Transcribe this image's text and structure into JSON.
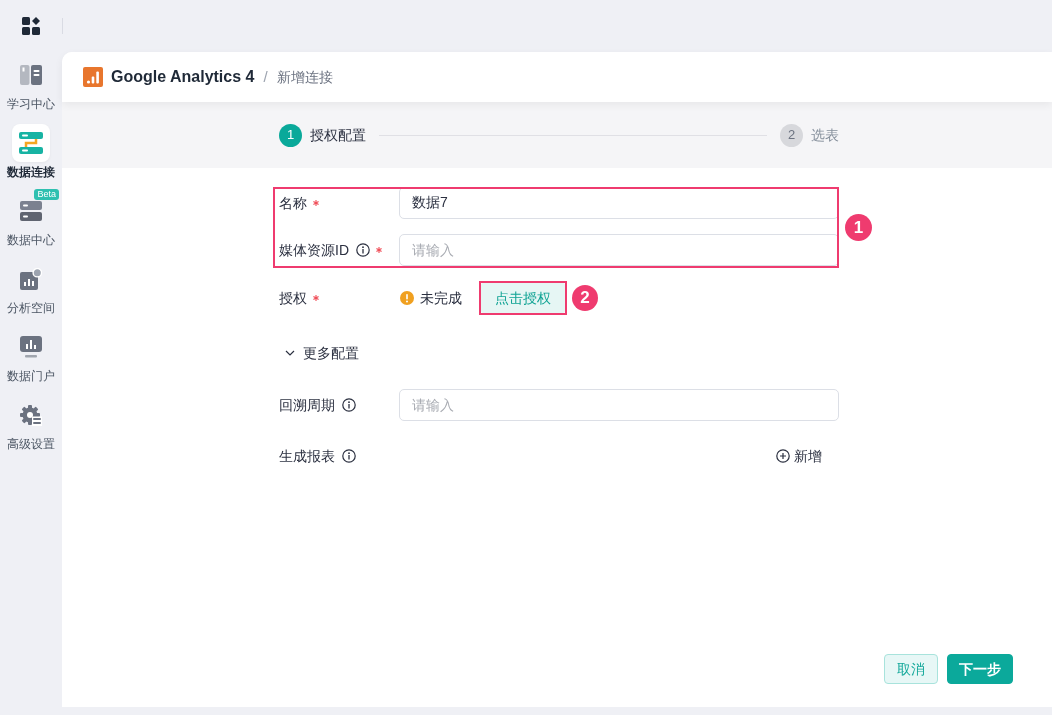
{
  "sidebar": {
    "items": [
      {
        "label": "学习中心",
        "selected": false
      },
      {
        "label": "数据连接",
        "selected": true
      },
      {
        "label": "数据中心",
        "selected": false,
        "badge": "Beta"
      },
      {
        "label": "分析空间",
        "selected": false
      },
      {
        "label": "数据门户",
        "selected": false
      },
      {
        "label": "高级设置",
        "selected": false
      }
    ]
  },
  "header": {
    "title": "Google Analytics 4",
    "separator": "/",
    "crumb": "新增连接"
  },
  "steps": [
    {
      "number": "1",
      "label": "授权配置",
      "selected": true
    },
    {
      "number": "2",
      "label": "选表",
      "selected": false
    }
  ],
  "form": {
    "rows": [
      {
        "kind": "input",
        "label": "名称",
        "required": true,
        "info": false,
        "value": "数据7"
      },
      {
        "kind": "input",
        "label": "媒体资源ID",
        "required": true,
        "info": true,
        "placeholder": "请输入"
      },
      {
        "kind": "auth",
        "label": "授权",
        "required": true,
        "info": false,
        "status": "未完成",
        "button": "点击授权"
      }
    ]
  },
  "more_config": {
    "label": "更多配置",
    "expanded": true,
    "rows": [
      {
        "kind": "input",
        "label": "回溯周期",
        "required": false,
        "info": true,
        "placeholder": "请输入"
      },
      {
        "kind": "list",
        "label": "生成报表",
        "required": false,
        "info": true,
        "add_button": "新增"
      }
    ]
  },
  "footer": {
    "buttons": [
      {
        "kind": "secondary",
        "label": "取消"
      },
      {
        "kind": "primary",
        "label": "下一步"
      }
    ]
  },
  "annotations": [
    {
      "label": "1"
    },
    {
      "label": "2"
    }
  ]
}
